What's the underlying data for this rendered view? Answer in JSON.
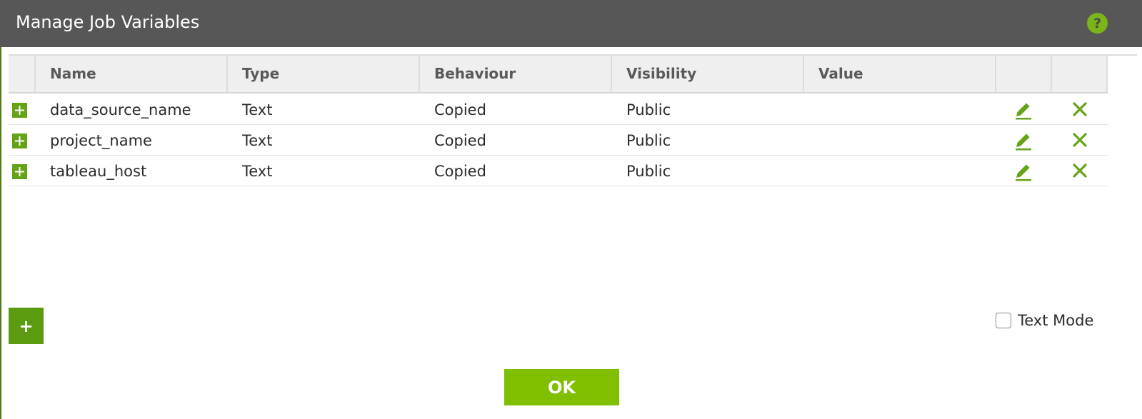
{
  "dialog": {
    "title": "Manage Job Variables",
    "help_icon": "question-circle-icon"
  },
  "table": {
    "columns": [
      "Name",
      "Type",
      "Behaviour",
      "Visibility",
      "Value",
      "",
      ""
    ],
    "rows": [
      {
        "name": "data_source_name",
        "type": "Text",
        "behaviour": "Copied",
        "visibility": "Public",
        "value": ""
      },
      {
        "name": "project_name",
        "type": "Text",
        "behaviour": "Copied",
        "visibility": "Public",
        "value": ""
      },
      {
        "name": "tableau_host",
        "type": "Text",
        "behaviour": "Copied",
        "visibility": "Public",
        "value": ""
      }
    ],
    "row_icons": {
      "expand": "plus-square-icon",
      "edit": "pencil-icon",
      "delete": "x-icon"
    }
  },
  "footer": {
    "add_label": "+",
    "text_mode_label": "Text Mode",
    "text_mode_checked": false,
    "ok_label": "OK"
  },
  "colors": {
    "titlebar": "#575757",
    "accent_green": "#7fbf00",
    "icon_green": "#65a316"
  }
}
